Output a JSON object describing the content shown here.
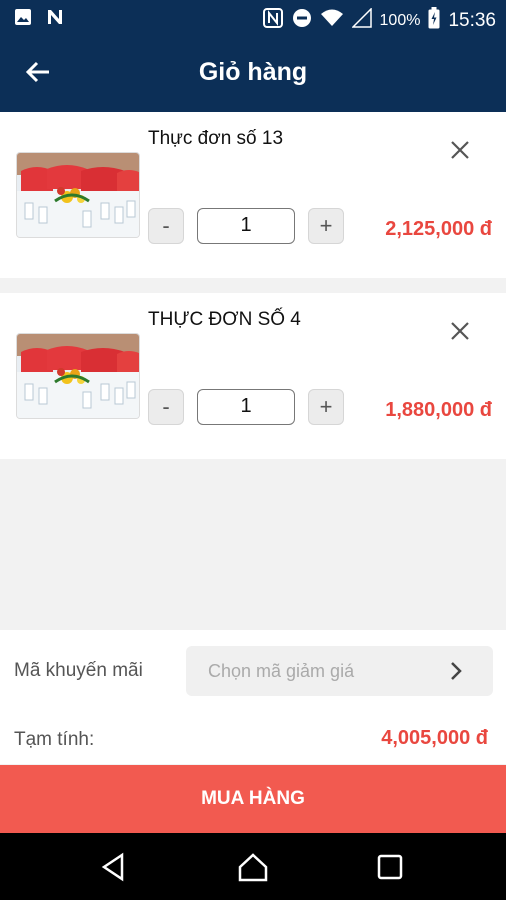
{
  "status_bar": {
    "battery": "100%",
    "time": "15:36",
    "icons": [
      "image-icon",
      "n-icon",
      "nfc-icon",
      "do-not-disturb-icon",
      "wifi-icon",
      "signal-icon",
      "battery-icon"
    ]
  },
  "header": {
    "title": "Giỏ hàng",
    "back_icon": "arrow-left-icon"
  },
  "cart": {
    "items": [
      {
        "name": "Thực đơn số 13",
        "quantity": "1",
        "minus": "-",
        "plus": "+",
        "price": "2,125,000 đ"
      },
      {
        "name": "THỰC ĐƠN SỐ 4",
        "quantity": "1",
        "minus": "-",
        "plus": "+",
        "price": "1,880,000 đ"
      }
    ]
  },
  "promo": {
    "label": "Mã khuyến mãi",
    "placeholder": "Chọn mã giảm giá"
  },
  "summary": {
    "subtotal_label": "Tạm tính:",
    "subtotal_value": "4,005,000 đ"
  },
  "checkout": {
    "button_label": "MUA HÀNG"
  },
  "colors": {
    "primary": "#0c2f57",
    "accent": "#e9473f",
    "buy_button": "#f25a50"
  }
}
